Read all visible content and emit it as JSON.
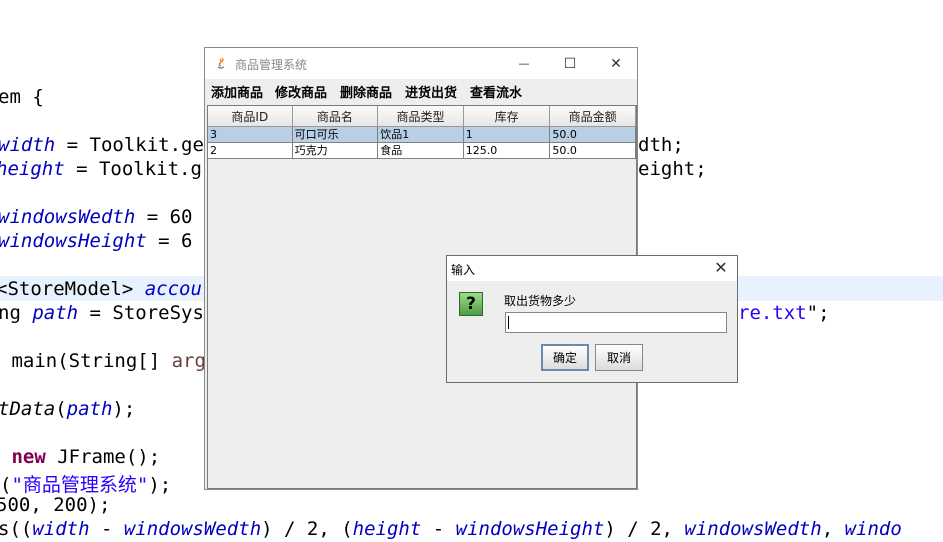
{
  "editor": {
    "lines": [
      {
        "id": "l1",
        "segments": [
          {
            "t": "em {",
            "c": ""
          }
        ]
      },
      {
        "id": "l2",
        "segments": [
          {
            "t": "width",
            "c": "var"
          },
          {
            "t": " = Toolkit.ge",
            "c": ""
          }
        ]
      },
      {
        "id": "l3",
        "segments": [
          {
            "t": "height",
            "c": "var"
          },
          {
            "t": " = Toolkit.g",
            "c": ""
          }
        ]
      },
      {
        "id": "l4",
        "segments": [
          {
            "t": "windowsWedth",
            "c": "var"
          },
          {
            "t": " = 60",
            "c": ""
          }
        ]
      },
      {
        "id": "l5",
        "segments": [
          {
            "t": "windowsHeight",
            "c": "var"
          },
          {
            "t": " = 6",
            "c": ""
          }
        ]
      },
      {
        "id": "l6",
        "segments": [
          {
            "t": "<StoreModel> ",
            "c": ""
          },
          {
            "t": "accou",
            "c": "var"
          }
        ]
      },
      {
        "id": "l7",
        "segments": [
          {
            "t": "ng ",
            "c": ""
          },
          {
            "t": "path",
            "c": "var"
          },
          {
            "t": " = StoreSys",
            "c": ""
          }
        ]
      },
      {
        "id": "l8",
        "segments": [
          {
            "t": " main(String[] ",
            "c": ""
          },
          {
            "t": "arg",
            "c": "arg"
          }
        ]
      },
      {
        "id": "l9",
        "segments": [
          {
            "t": "tData",
            "c": "italic"
          },
          {
            "t": "(",
            "c": ""
          },
          {
            "t": "path",
            "c": "var"
          },
          {
            "t": ");",
            "c": ""
          }
        ]
      },
      {
        "id": "l10",
        "segments": [
          {
            "t": " ",
            "c": ""
          },
          {
            "t": "new",
            "c": "kw"
          },
          {
            "t": " JFrame();",
            "c": ""
          }
        ]
      },
      {
        "id": "l11",
        "segments": [
          {
            "t": "(",
            "c": ""
          },
          {
            "t": "\"商品管理系统\"",
            "c": "str"
          },
          {
            "t": ");",
            "c": ""
          }
        ]
      },
      {
        "id": "l12",
        "segments": [
          {
            "t": "500, 200);",
            "c": ""
          }
        ]
      },
      {
        "id": "l13",
        "segments": [
          {
            "t": "s((",
            "c": ""
          },
          {
            "t": "width",
            "c": "var"
          },
          {
            "t": " - ",
            "c": ""
          },
          {
            "t": "windowsWedth",
            "c": "var"
          },
          {
            "t": ") / 2, (",
            "c": ""
          },
          {
            "t": "height",
            "c": "var"
          },
          {
            "t": " - ",
            "c": ""
          },
          {
            "t": "windowsHeight",
            "c": "var"
          },
          {
            "t": ") / 2, ",
            "c": ""
          },
          {
            "t": "windowsWedth",
            "c": "var"
          },
          {
            "t": ", ",
            "c": ""
          },
          {
            "t": "windo",
            "c": "var"
          }
        ]
      }
    ],
    "right_fragments": [
      {
        "id": "r2",
        "segments": [
          {
            "t": "dth;",
            "c": ""
          }
        ]
      },
      {
        "id": "r3",
        "segments": [
          {
            "t": "eight;",
            "c": ""
          }
        ]
      },
      {
        "id": "r7",
        "segments": [
          {
            "t": "re.txt",
            "c": "str"
          },
          {
            "t": "\";",
            "c": ""
          }
        ]
      }
    ]
  },
  "window": {
    "title": "商品管理系统",
    "minimize_glyph": "—",
    "maximize_glyph": "☐",
    "close_glyph": "✕",
    "menu": [
      "添加商品",
      "修改商品",
      "删除商品",
      "进货出货",
      "查看流水"
    ],
    "table": {
      "columns": [
        "商品ID",
        "商品名",
        "商品类型",
        "库存",
        "商品金额"
      ],
      "rows": [
        [
          "3",
          "可口可乐",
          "饮品1",
          "1",
          "50.0"
        ],
        [
          "2",
          "巧克力",
          "食品",
          "125.0",
          "50.0"
        ]
      ],
      "selected_row": 0
    }
  },
  "dialog": {
    "title": "输入",
    "close_glyph": "✕",
    "icon_glyph": "?",
    "message": "取出货物多少",
    "input_value": "",
    "ok_label": "确定",
    "cancel_label": "取消"
  },
  "colors": {
    "keyword": "#7f0055",
    "variable": "#0000c0",
    "string": "#2a00ff",
    "selection": "#b8cfe5",
    "current_line": "#e8f2fe"
  }
}
